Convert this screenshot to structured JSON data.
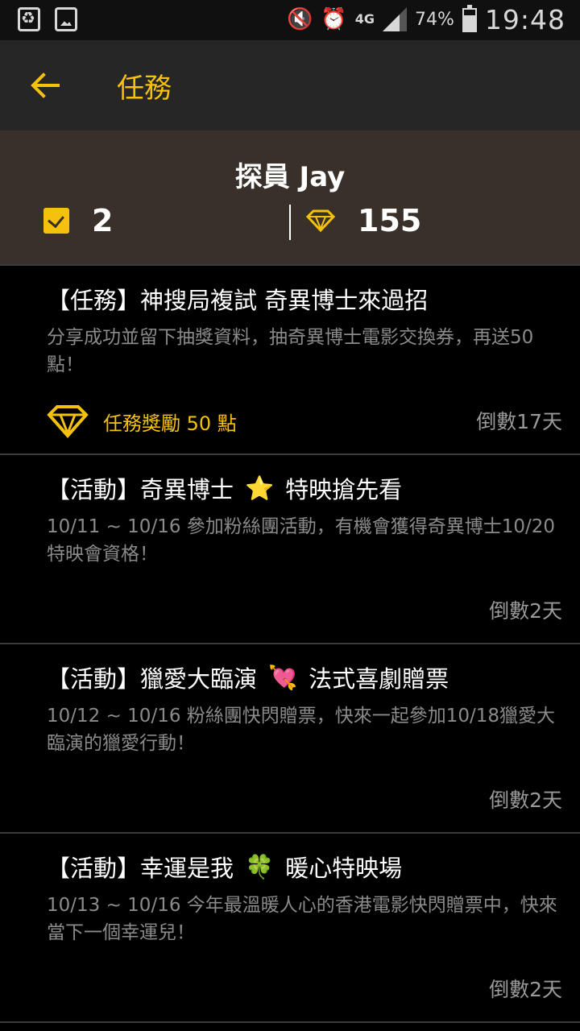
{
  "status_bar": {
    "battery_percent": "74%",
    "time": "19:48",
    "network": "4G",
    "icons": [
      "recycle-icon",
      "image-icon",
      "mute-icon",
      "alarm-icon",
      "signal-icon",
      "battery-icon"
    ]
  },
  "app_bar": {
    "title": "任務"
  },
  "profile": {
    "name": "探員 Jay",
    "tasks_count": "2",
    "points": "155"
  },
  "colors": {
    "accent": "#f4c20d",
    "background": "#000000",
    "header_bg": "#383029",
    "appbar_bg": "#262626"
  },
  "missions": [
    {
      "title_prefix": "【任務】",
      "title_main": "神搜局複試 奇異博士來過招",
      "title_emoji": "",
      "title_suffix": "",
      "description": "分享成功並留下抽獎資料，抽奇異博士電影交換券，再送50點！",
      "reward": "任務獎勵 50 點",
      "countdown": "倒數17天"
    },
    {
      "title_prefix": "【活動】",
      "title_main": "奇異博士",
      "title_emoji": "⭐",
      "title_suffix": "特映搶先看",
      "description": "10/11 ~ 10/16 參加粉絲團活動，有機會獲得奇異博士10/20特映會資格！",
      "reward": "",
      "countdown": "倒數2天"
    },
    {
      "title_prefix": "【活動】",
      "title_main": "獵愛大臨演",
      "title_emoji": "💘",
      "title_suffix": "法式喜劇贈票",
      "description": "10/12 ~ 10/16 粉絲團快閃贈票，快來一起參加10/18獵愛大臨演的獵愛行動！",
      "reward": "",
      "countdown": "倒數2天"
    },
    {
      "title_prefix": "【活動】",
      "title_main": "幸運是我",
      "title_emoji": "🍀",
      "title_suffix": "暖心特映場",
      "description": "10/13 ~ 10/16 今年最溫暖人心的香港電影快閃贈票中，快來當下一個幸運兒！",
      "reward": "",
      "countdown": "倒數2天"
    }
  ]
}
